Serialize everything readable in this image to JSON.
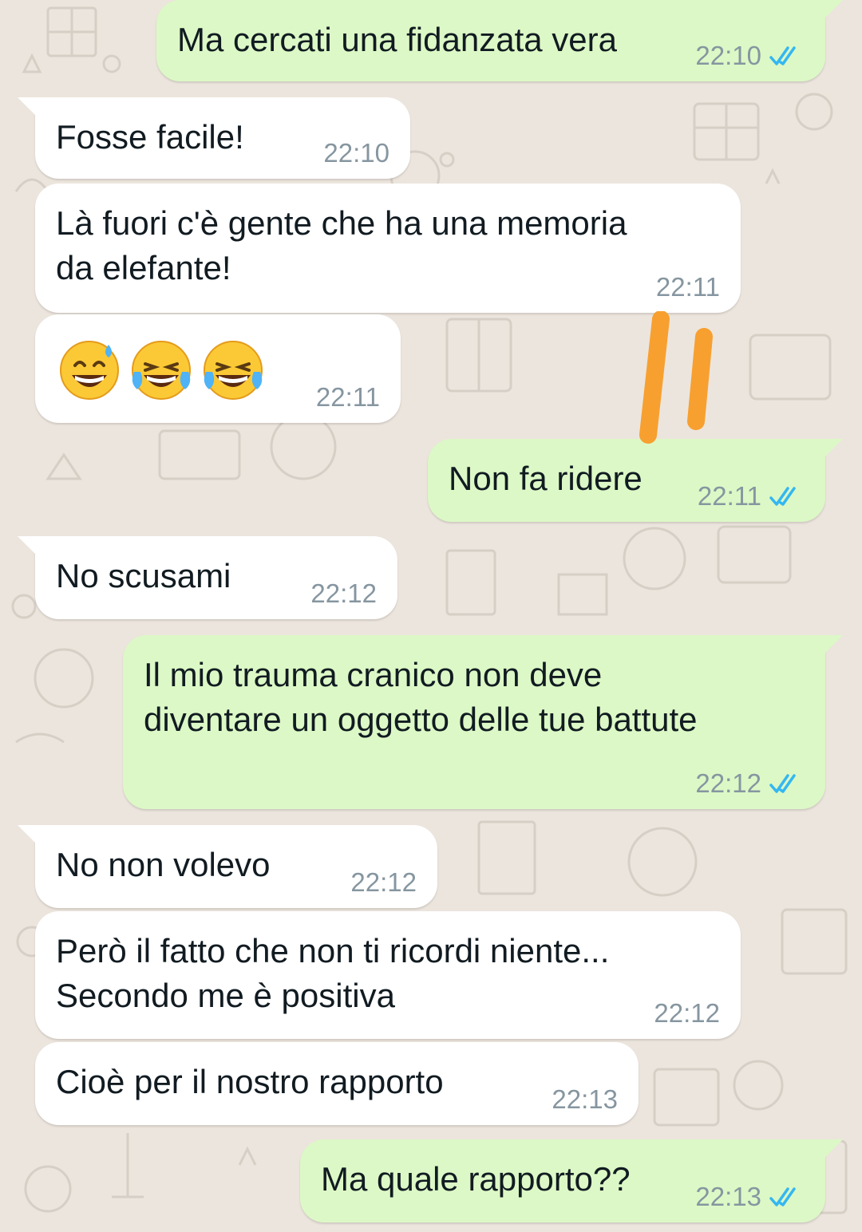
{
  "chat": {
    "messages": [
      {
        "direction": "out",
        "text": "Ma cercati una fidanzata vera",
        "time": "22:10",
        "status": "read"
      },
      {
        "direction": "in",
        "text": "Fosse facile!",
        "time": "22:10"
      },
      {
        "direction": "in",
        "text": "Là fuori c'è gente che ha una memoria\nda elefante!",
        "time": "22:11"
      },
      {
        "direction": "in",
        "emoji": [
          "grinning-sweat-emoji",
          "tears-of-joy-emoji",
          "tears-of-joy-emoji"
        ],
        "time": "22:11"
      },
      {
        "direction": "out",
        "text": "Non fa ridere",
        "time": "22:11",
        "status": "read"
      },
      {
        "direction": "in",
        "text": "No scusami",
        "time": "22:12"
      },
      {
        "direction": "out",
        "text": "Il mio trauma cranico non deve\ndiventare un oggetto delle tue battute",
        "time": "22:12",
        "status": "read"
      },
      {
        "direction": "in",
        "text": "No non volevo",
        "time": "22:12"
      },
      {
        "direction": "in",
        "text": "Però il fatto che non ti ricordi niente...\nSecondo me è positiva",
        "time": "22:12"
      },
      {
        "direction": "in",
        "text": "Cioè per il nostro rapporto",
        "time": "22:13"
      },
      {
        "direction": "out",
        "text": "Ma quale rapporto??",
        "time": "22:13",
        "status": "read"
      }
    ]
  },
  "colors": {
    "background": "#ECE5DD",
    "incoming_bubble": "#FFFFFF",
    "outgoing_bubble": "#DCF8C6",
    "timestamp": "#8696A0",
    "read_check": "#34B7F1",
    "marker": "#F7A030"
  }
}
